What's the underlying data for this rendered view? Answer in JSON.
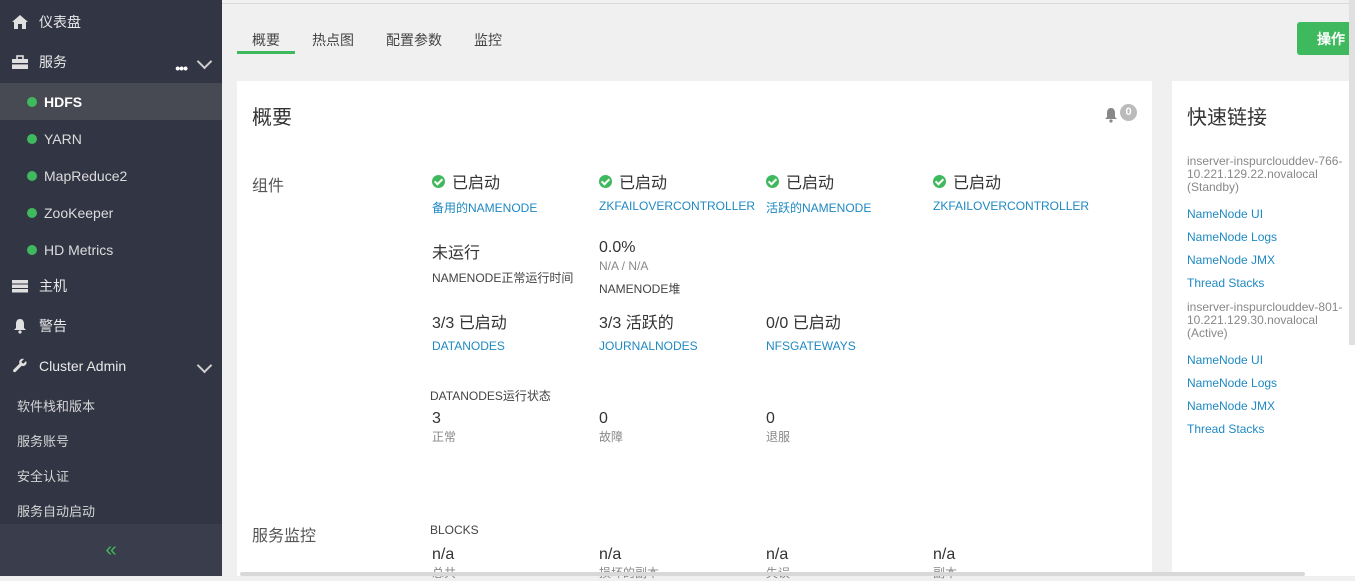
{
  "sidebar": {
    "dashboard": "仪表盘",
    "services": "服务",
    "services_list": [
      "HDFS",
      "YARN",
      "MapReduce2",
      "ZooKeeper",
      "HD Metrics"
    ],
    "hosts": "主机",
    "alerts": "警告",
    "cluster_admin": "Cluster Admin",
    "admin_items": [
      "软件栈和版本",
      "服务账号",
      "安全认证",
      "服务自动启动"
    ],
    "collapse_glyph": "«"
  },
  "tabs": [
    "概要",
    "热点图",
    "配置参数",
    "监控"
  ],
  "action_button": "操作",
  "summary": {
    "title": "概要",
    "alert_count": "0",
    "components_label": "组件",
    "started": [
      "已启动",
      "已启动",
      "已启动",
      "已启动"
    ],
    "started_links": [
      "备用的NAMENODE",
      "ZKFAILOVERCONTROLLER",
      "活跃的NAMENODE",
      "ZKFAILOVERCONTROLLER"
    ],
    "uptime_value": "未运行",
    "uptime_label": "NAMENODE正常运行时间",
    "heap_value": "0.0%",
    "heap_sub": "N/A / N/A",
    "heap_label": "NAMENODE堆",
    "datanodes_value": "3/3 已启动",
    "datanodes_link": "DATANODES",
    "journalnodes_value": "3/3 活跃的",
    "journalnodes_link": "JOURNALNODES",
    "nfs_value": "0/0 已启动",
    "nfs_link": "NFSGATEWAYS",
    "dn_status_label": "DATANODES运行状态",
    "dn_status": [
      {
        "value": "3",
        "label": "正常"
      },
      {
        "value": "0",
        "label": "故障"
      },
      {
        "value": "0",
        "label": "退服"
      }
    ],
    "monitor_label": "服务监控",
    "blocks_label": "BLOCKS",
    "blocks": [
      {
        "value": "n/a",
        "label": "总共"
      },
      {
        "value": "n/a",
        "label": "损坏的副本"
      },
      {
        "value": "n/a",
        "label": "失误"
      },
      {
        "value": "n/a",
        "label": "副本"
      }
    ]
  },
  "quick_links": {
    "title": "快速链接",
    "hosts": [
      {
        "name": "inserver-inspurclouddev-766-10.221.129.22.novalocal (Standby)",
        "links": [
          "NameNode UI",
          "NameNode Logs",
          "NameNode JMX",
          "Thread Stacks"
        ]
      },
      {
        "name": "inserver-inspurclouddev-801-10.221.129.30.novalocal (Active)",
        "links": [
          "NameNode UI",
          "NameNode Logs",
          "NameNode JMX",
          "Thread Stacks"
        ]
      }
    ]
  },
  "colors": {
    "sidebar_bg": "#323544",
    "accent_green": "#3fb95d",
    "link_blue": "#1f89c2"
  }
}
